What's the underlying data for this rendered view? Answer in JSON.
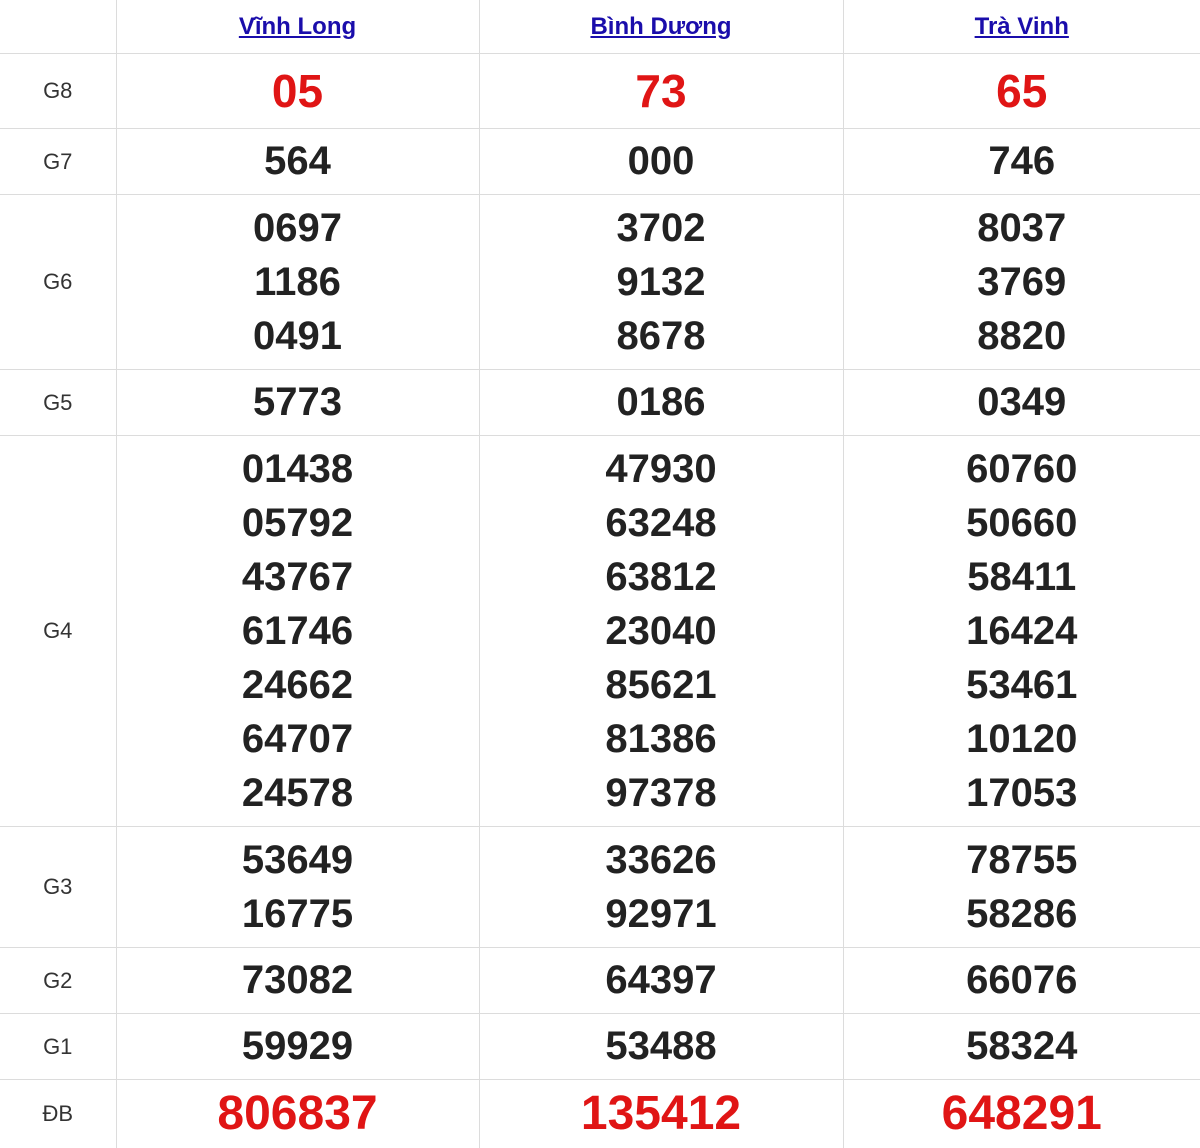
{
  "provinces": [
    "Vĩnh Long",
    "Bình Dương",
    "Trà Vinh"
  ],
  "prizes": [
    {
      "label": "G8",
      "values": [
        [
          "05"
        ],
        [
          "73"
        ],
        [
          "65"
        ]
      ]
    },
    {
      "label": "G7",
      "values": [
        [
          "564"
        ],
        [
          "000"
        ],
        [
          "746"
        ]
      ]
    },
    {
      "label": "G6",
      "values": [
        [
          "0697",
          "1186",
          "0491"
        ],
        [
          "3702",
          "9132",
          "8678"
        ],
        [
          "8037",
          "3769",
          "8820"
        ]
      ]
    },
    {
      "label": "G5",
      "values": [
        [
          "5773"
        ],
        [
          "0186"
        ],
        [
          "0349"
        ]
      ]
    },
    {
      "label": "G4",
      "values": [
        [
          "01438",
          "05792",
          "43767",
          "61746",
          "24662",
          "64707",
          "24578"
        ],
        [
          "47930",
          "63248",
          "63812",
          "23040",
          "85621",
          "81386",
          "97378"
        ],
        [
          "60760",
          "50660",
          "58411",
          "16424",
          "53461",
          "10120",
          "17053"
        ]
      ]
    },
    {
      "label": "G3",
      "values": [
        [
          "53649",
          "16775"
        ],
        [
          "33626",
          "92971"
        ],
        [
          "78755",
          "58286"
        ]
      ]
    },
    {
      "label": "G2",
      "values": [
        [
          "73082"
        ],
        [
          "64397"
        ],
        [
          "66076"
        ]
      ]
    },
    {
      "label": "G1",
      "values": [
        [
          "59929"
        ],
        [
          "53488"
        ],
        [
          "58324"
        ]
      ]
    },
    {
      "label": "ĐB",
      "values": [
        [
          "806837"
        ],
        [
          "135412"
        ],
        [
          "648291"
        ]
      ]
    }
  ],
  "colors": {
    "special": "#e01515",
    "link": "#1a0dab",
    "text": "#222222"
  }
}
